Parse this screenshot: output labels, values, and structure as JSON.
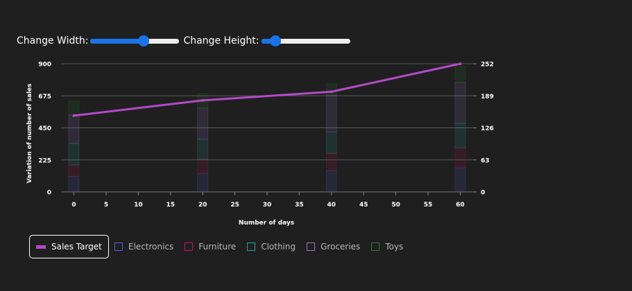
{
  "controls": {
    "width_label": "Change Width:",
    "width_value": 0.6,
    "height_label": "Change Height:",
    "height_value": 0.16
  },
  "chart_data": {
    "type": "bar",
    "xlabel": "Number of days",
    "ylabel": "Variation of number of sales",
    "x_ticks": [
      "0",
      "5",
      "10",
      "15",
      "20",
      "25",
      "30",
      "35",
      "40",
      "45",
      "50",
      "55",
      "60"
    ],
    "xlim": [
      -2,
      62
    ],
    "y_left_ticks": [
      "0",
      "225",
      "450",
      "675",
      "900"
    ],
    "ylim_left": [
      0,
      900
    ],
    "y_right_ticks": [
      "0",
      "63",
      "126",
      "189",
      "252"
    ],
    "ylim_right": [
      0,
      252
    ],
    "grid": true,
    "legend_position": "bottom-left",
    "stacked_series": [
      {
        "name": "Electronics",
        "color": "#5566d6",
        "x": [
          0,
          20,
          40,
          60
        ],
        "values": [
          110,
          130,
          150,
          170
        ]
      },
      {
        "name": "Furniture",
        "color": "#c2185b",
        "x": [
          0,
          20,
          40,
          60
        ],
        "values": [
          80,
          100,
          120,
          140
        ]
      },
      {
        "name": "Clothing",
        "color": "#26a69a",
        "x": [
          0,
          20,
          40,
          60
        ],
        "values": [
          150,
          140,
          150,
          170
        ]
      },
      {
        "name": "Groceries",
        "color": "#9575cd",
        "x": [
          0,
          20,
          40,
          60
        ],
        "values": [
          200,
          220,
          260,
          290
        ]
      },
      {
        "name": "Toys",
        "color": "#2e7d32",
        "x": [
          0,
          20,
          40,
          60
        ],
        "values": [
          100,
          100,
          80,
          110
        ]
      }
    ],
    "line_series": {
      "name": "Sales Target",
      "color": "#b44ac8",
      "x": [
        0,
        20,
        40,
        60
      ],
      "values": [
        150,
        180,
        197,
        252
      ]
    }
  },
  "legend": {
    "items": [
      {
        "label": "Sales Target",
        "color": "#b44ac8",
        "kind": "line",
        "active": true
      },
      {
        "label": "Electronics",
        "color": "#5566d6",
        "kind": "box",
        "active": false
      },
      {
        "label": "Furniture",
        "color": "#c2185b",
        "kind": "box",
        "active": false
      },
      {
        "label": "Clothing",
        "color": "#26a69a",
        "kind": "box",
        "active": false
      },
      {
        "label": "Groceries",
        "color": "#9575cd",
        "kind": "box",
        "active": false
      },
      {
        "label": "Toys",
        "color": "#2e7d32",
        "kind": "box",
        "active": false
      }
    ]
  }
}
